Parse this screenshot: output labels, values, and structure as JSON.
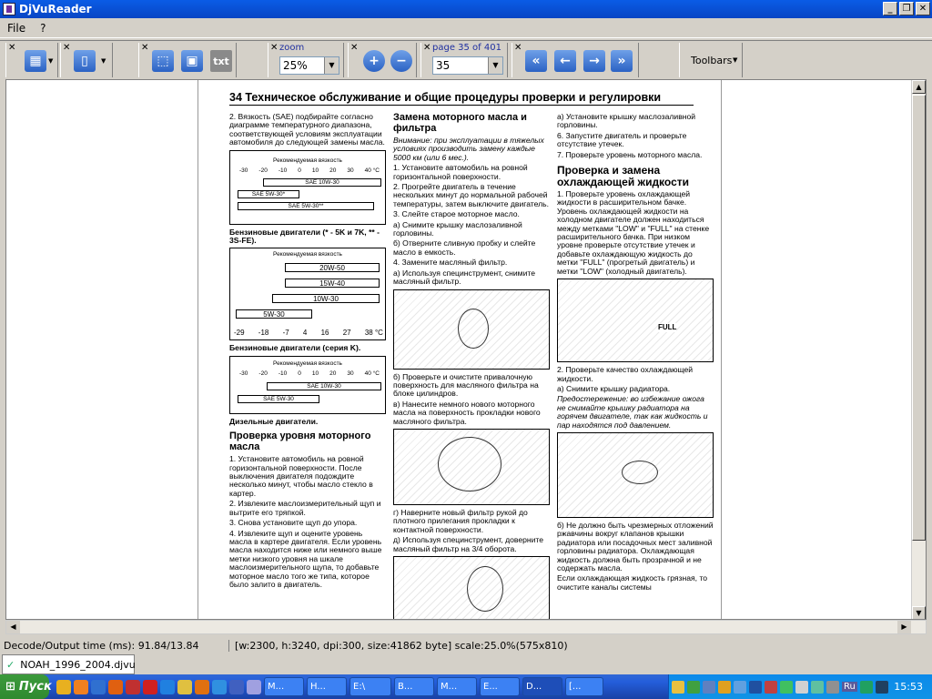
{
  "window": {
    "title": "DjVuReader"
  },
  "menu": [
    "File",
    "?"
  ],
  "toolbar": {
    "zoom_label": "zoom",
    "zoom_value": "25%",
    "page_label": "page 35 of 401",
    "page_value": "35",
    "text_button": "txt",
    "toolbars_label": "Toolbars"
  },
  "page": {
    "header": "34  Техническое обслуживание и общие процедуры проверки и регулировки",
    "col1": {
      "intro": "2. Вязкость (SAE) подбирайте согласно диаграмме температурного диапазона, соответствующей условиям эксплуатации автомобиля до следующей замены масла.",
      "chart1_title": "Рекомендуемая вязкость",
      "chart1_ticks": [
        "-30",
        "-20",
        "-10",
        "0",
        "10",
        "20",
        "30",
        "40 °C"
      ],
      "chart1_bars": [
        "SAE 10W-30",
        "SAE 5W-30*",
        "SAE 5W-30**"
      ],
      "caption1": "Бензиновые двигатели (* - 5K и 7K, ** - 3S-FE).",
      "chart2_title": "Рекомендуемая вязкость",
      "chart2_bars": [
        "20W-50",
        "15W-40",
        "10W-30",
        "5W-30"
      ],
      "chart2_ticks": [
        "-29",
        "-18",
        "-7",
        "4",
        "16",
        "27",
        "38 °C"
      ],
      "caption2": "Бензиновые двигатели (серия K).",
      "chart3_title": "Рекомендуемая вязкость",
      "chart3_ticks": [
        "-30",
        "-20",
        "-10",
        "0",
        "10",
        "20",
        "30",
        "40 °C"
      ],
      "chart3_bars": [
        "SAE 10W-30",
        "SAE 5W-30"
      ],
      "caption3": "Дизельные двигатели.",
      "h_level": "Проверка уровня моторного масла",
      "level_text": "1. Установите автомобиль на ровной горизонтальной поверхности. После выключения двигателя подождите несколько минут, чтобы масло стекло в картер.",
      "level_text2": "2. Извлеките маслоизмерительный щуп и вытрите его тряпкой.",
      "level_text3": "3. Снова установите щуп до упора.",
      "level_text4": "4. Извлеките щуп и оцените уровень масла в картере двигателя. Если уровень масла находится ниже или немного выше метки низкого уровня на шкале маслоизмерительного щупа, то добавьте моторное масло того же типа, которое было залито в двигатель."
    },
    "col2": {
      "h_change": "Замена моторного масла и фильтра",
      "note": "Внимание: при эксплуатации в тяжелых условиях производить замену каждые 5000 км (или 6 мес.).",
      "s1": "1. Установите автомобиль на ровной горизонтальной поверхности.",
      "s2": "2. Прогрейте двигатель в течение нескольких минут до нормальной рабочей температуры, затем выключите двигатель.",
      "s3": "3. Слейте старое моторное масло.",
      "s3a": "а) Снимите крышку маслозаливной горловины.",
      "s3b": "б) Отверните сливную пробку и слейте масло в емкость.",
      "s4": "4. Замените масляный фильтр.",
      "s4a": "а) Используя специнструмент, снимите масляный фильтр.",
      "s4b": "б) Проверьте и очистите привалочную поверхность для масляного фильтра на блоке цилиндров.",
      "s4c": "в) Нанесите немного нового моторного масла на поверхность прокладки нового масляного фильтра.",
      "s4d": "г) Наверните новый фильтр рукой до плотного прилегания прокладки к контактной поверхности.",
      "s4e": "д) Используя специнструмент, доверните масляный фильтр на 3/4 оборота."
    },
    "col3": {
      "s5a": "а) Установите крышку маслозаливной горловины.",
      "s6": "6. Запустите двигатель и проверьте отсутствие утечек.",
      "s7": "7. Проверьте уровень моторного масла.",
      "h_cool": "Проверка и замена охлаждающей жидкости",
      "c1": "1. Проверьте уровень охлаждающей жидкости в расширительном бачке. Уровень охлаждающей жидкости на холодном двигателе должен находиться между метками \"LOW\" и \"FULL\" на стенке расширительного бачка. При низком уровне проверьте отсутствие утечек и добавьте охлаждающую жидкость до метки \"FULL\" (прогретый двигатель) и метки \"LOW\" (холодный двигатель).",
      "fig_label": "FULL",
      "c2": "2. Проверьте качество охлаждающей жидкости.",
      "c2a": "а) Снимите крышку радиатора.",
      "warn": "Предостережение: во избежание ожога не снимайте крышку радиатора на горячем двигателе, так как жидкость и пар находятся под давлением.",
      "c2b": "б) Не должно быть чрезмерных отложений ржавчины вокруг клапанов крышки радиатора или посадочных мест заливной горловины радиатора. Охлаждающая жидкость должна быть прозрачной и не содержать масла.",
      "c2c": "Если охлаждающая жидкость грязная, то очистите каналы системы"
    }
  },
  "status": {
    "decode": "Decode/Output time (ms): 91.84/13.84",
    "info": "[w:2300, h:3240, dpi:300, size:41862 byte] scale:25.0%(575x810)"
  },
  "doc_tab": "NOAH_1996_2004.djvu",
  "taskbar": {
    "start": "Пуск",
    "items": [
      "M...",
      "H...",
      "E:\\",
      "B...",
      "M...",
      "E...",
      "D...",
      "[..."
    ],
    "tray_lang": "Ru",
    "clock": "15:53"
  }
}
